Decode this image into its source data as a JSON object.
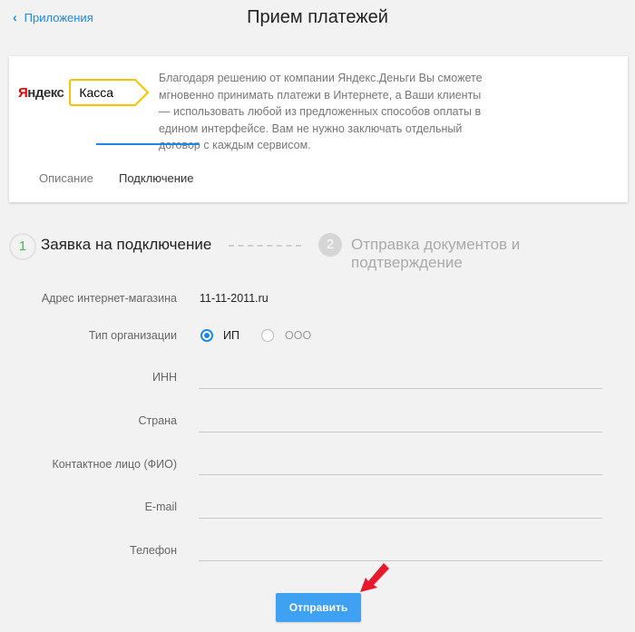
{
  "header": {
    "back_label": "Приложения",
    "title": "Прием платежей"
  },
  "card": {
    "logo_yandex_first": "Я",
    "logo_yandex_rest": "ндекс",
    "logo_kassa": "Касса",
    "description": "Благодаря решению от компании Яндекс.Деньги Вы сможете мгновенно принимать платежи в Интернете, а Ваши клиенты — использовать любой из предложенных способов оплаты в едином интерфейсе. Вам не нужно заключать отдельный договор с каждым сервисом.",
    "tabs": [
      {
        "label": "Описание",
        "active": false
      },
      {
        "label": "Подключение",
        "active": true
      }
    ]
  },
  "steps": [
    {
      "number": "1",
      "label": "Заявка на подключение",
      "active": true
    },
    {
      "number": "2",
      "label": "Отправка документов и подтверждение",
      "active": false
    }
  ],
  "form": {
    "shop_address_label": "Адрес интернет-магазина",
    "shop_address_value": "11-11-2011.ru",
    "org_type_label": "Тип организации",
    "org_options": [
      {
        "label": "ИП",
        "selected": true
      },
      {
        "label": "ООО",
        "selected": false
      }
    ],
    "fields": [
      {
        "label": "ИНН",
        "value": ""
      },
      {
        "label": "Страна",
        "value": ""
      },
      {
        "label": "Контактное лицо (ФИО)",
        "value": ""
      },
      {
        "label": "E-mail",
        "value": ""
      },
      {
        "label": "Телефон",
        "value": ""
      }
    ],
    "submit_label": "Отправить"
  },
  "colors": {
    "accent": "#1e88e5",
    "button": "#3ea1f1",
    "step_active": "#3ac24a",
    "arrow": "#e8192c",
    "logo_frame": "#f5c400"
  }
}
